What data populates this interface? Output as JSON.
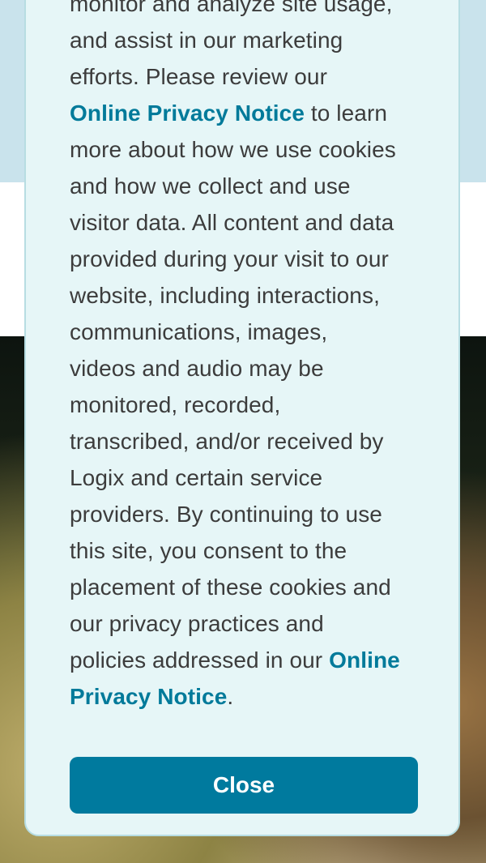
{
  "cookie_notice": {
    "lines": [
      "monitor and analyze site usage,",
      "and assist in our marketing",
      "efforts. Please review our",
      "",
      "more about how we use cookies",
      "and how we collect and use",
      "visitor data. All content and data",
      "provided during your visit to our",
      "website, including interactions,",
      "communications, images,",
      "videos and audio may be",
      "monitored, recorded,",
      "transcribed, and/or received by",
      "Logix and certain service",
      "providers. By continuing to use",
      "this site, you consent to the",
      "placement of these cookies and",
      "our privacy practices and",
      "policies addressed in our"
    ],
    "link_label_1": "Online Privacy Notice",
    "after_link_1": " to learn",
    "link_label_2a": "Online",
    "link_label_2b": "Privacy Notice",
    "final_period": ".",
    "close_label": "Close"
  },
  "colors": {
    "link": "#007a9a",
    "button": "#007a9e",
    "modal_bg": "#e6f6f7",
    "text": "#3c3c3c"
  }
}
